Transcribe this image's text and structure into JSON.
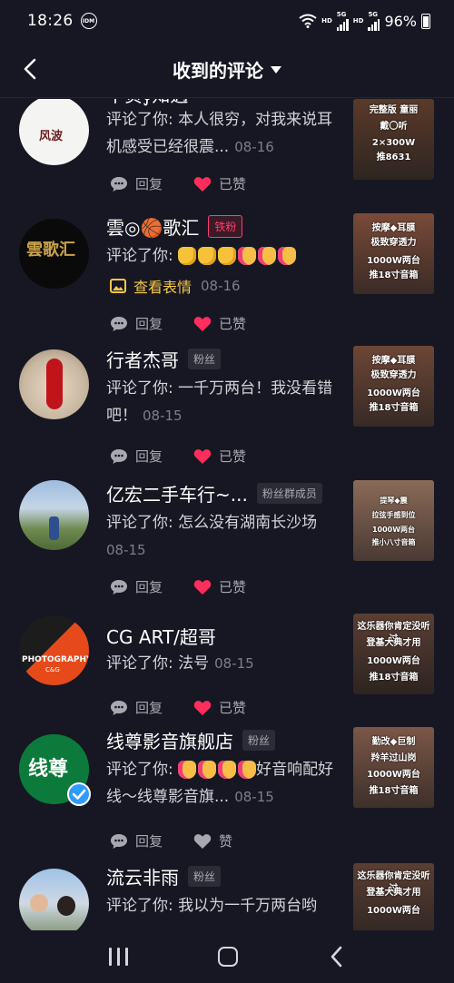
{
  "status": {
    "time": "18:26",
    "idm": "IDM",
    "hd1": "HD",
    "sig1": "5G",
    "hd2": "HD",
    "sig2": "5G",
    "battery": "96%"
  },
  "header": {
    "title": "收到的评论"
  },
  "actions": {
    "reply": "回复",
    "liked": "已赞",
    "like": "赞"
  },
  "comments": [
    {
      "name": "不负∮知遇",
      "badge": "",
      "text": "评论了你: 本人很穷，对我来说耳机感受已经很震...",
      "date": "08-16",
      "liked": true,
      "thumb": [
        "完整版 童丽",
        "戴〇听",
        "2×300W",
        "推8631"
      ]
    },
    {
      "name": "雲◎🏀歌汇",
      "badge": "铁粉",
      "text": "评论了你: ",
      "sticker": "查看表情",
      "date": "08-16",
      "liked": true,
      "thumb": [
        "按摩◆耳膜",
        "极致穿透力",
        "1000W两台",
        "推18寸音箱"
      ]
    },
    {
      "name": "行者杰哥",
      "badge": "粉丝",
      "text": "评论了你: 一千万两台！我没看错吧！",
      "date": "08-15",
      "liked": true,
      "thumb": [
        "按摩◆耳膜",
        "极致穿透力",
        "1000W两台",
        "推18寸音箱"
      ]
    },
    {
      "name": "亿宏二手车行~...",
      "badge": "粉丝群成员",
      "text": "评论了你: 怎么没有湖南长沙场",
      "date": "08-15",
      "liked": true,
      "thumb": [
        "提琴◆震",
        "拉弦手感到位",
        "1000W两台",
        "推小八寸音箱"
      ]
    },
    {
      "name": "CG ART/超哥",
      "badge": "",
      "text": "评论了你: 法号",
      "date": "08-15",
      "liked": true,
      "thumb": [
        "这乐器你肯定没听过",
        "登基大典才用",
        "1000W两台",
        "推18寸音箱"
      ]
    },
    {
      "name": "线尊影音旗舰店",
      "badge": "粉丝",
      "text": "好音响配好线～线尊影音旗...",
      "date": "08-15",
      "liked": false,
      "thumb": [
        "勤改◆巨制",
        "羚羊过山岗",
        "1000W两台",
        "推18寸音箱"
      ]
    },
    {
      "name": "流云非雨",
      "badge": "粉丝",
      "text": "评论了你: 我以为一千万两台哟",
      "date": "",
      "liked": false,
      "thumb": [
        "这乐器你肯定没听过",
        "登基大典才用",
        "1000W两台"
      ]
    }
  ],
  "avatar_text": {
    "a1": "风波",
    "a2": "雲歌汇",
    "a5": "PHOTOGRAPHY",
    "a5b": "C&G",
    "a6": "线尊"
  },
  "prefix": "评论了你: ",
  "colors": {
    "background": "#161722",
    "like": "#ff2d5b",
    "sticker": "#f7c845"
  }
}
